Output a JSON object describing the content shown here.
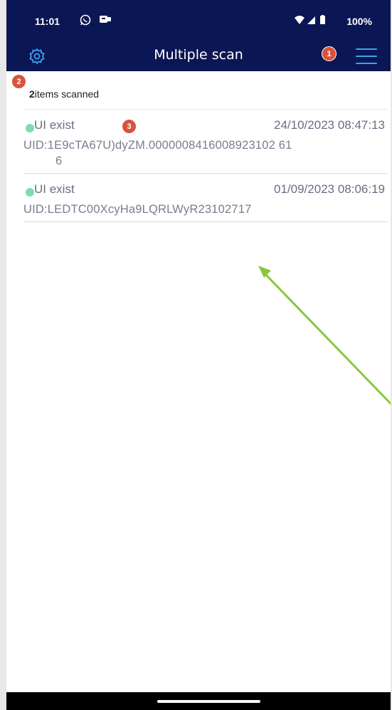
{
  "status_bar": {
    "time": "11:01",
    "battery": "100%",
    "icons": [
      "whatsapp-icon",
      "notification-icon",
      "wifi-icon",
      "signal-icon",
      "battery-icon"
    ]
  },
  "app_bar": {
    "title": "Multiple scan",
    "settings_icon": "gear-icon",
    "menu_icon": "hamburger-menu-icon",
    "background_color": "#0b1654",
    "icon_color": "#3aa3f0"
  },
  "markers": [
    "1",
    "2",
    "3"
  ],
  "summary": {
    "count": "2",
    "text": "items scanned"
  },
  "items": [
    {
      "status": "UI exist",
      "timestamp": "24/10/2023 08:47:13",
      "uid_line1": "UID:1E9cTA67U)dyZM.0000008416008923102 61",
      "uid_line2": "6"
    },
    {
      "status": "UI exist",
      "timestamp": "01/09/2023 08:06:19",
      "uid_line1": "UID:LEDTC00XcyHa9LQRLWyR23102717",
      "uid_line2": ""
    }
  ],
  "colors": {
    "status_dot": "#7fdcaa",
    "marker": "#d8533b",
    "annotation_arrow": "#8cc63f"
  }
}
